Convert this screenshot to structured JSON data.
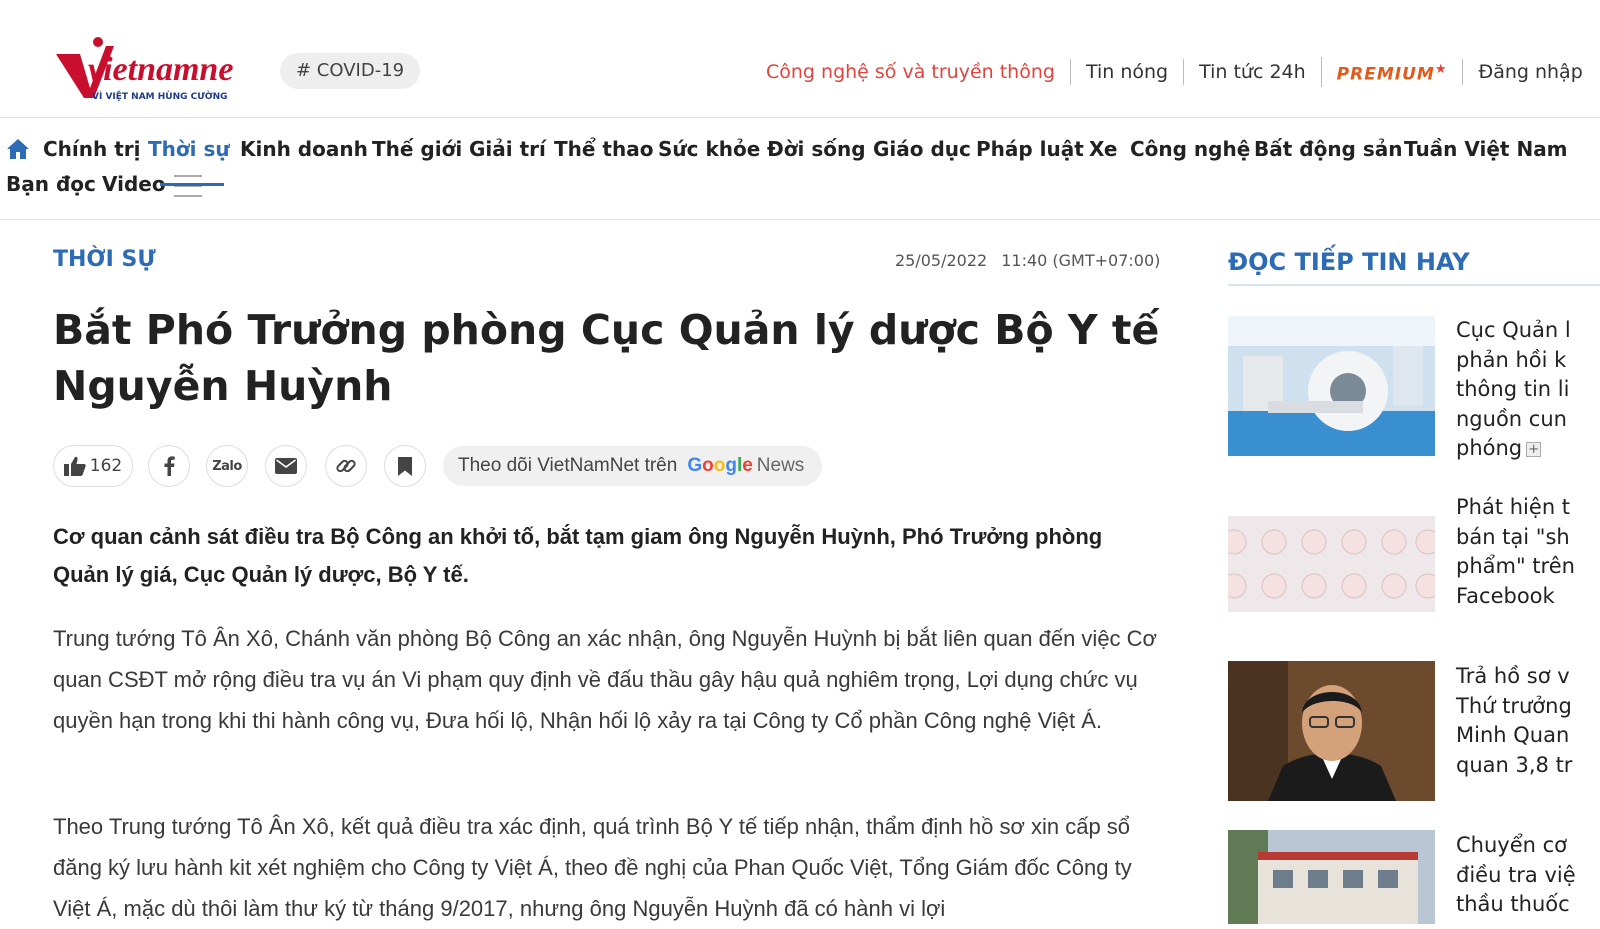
{
  "header": {
    "logo_text": "vietnamnet",
    "logo_tagline": "VÌ VIỆT NAM HÙNG CƯỜNG",
    "hashtag": "# COVID-19",
    "top_links": [
      "Công nghệ số và truyền thông",
      "Tin nóng",
      "Tin tức 24h",
      "PREMIUM",
      "Đăng nhập"
    ]
  },
  "nav": {
    "items": [
      "Chính trị",
      "Thời sự",
      "Kinh doanh",
      "Thế giới",
      "Giải trí",
      "Thể thao",
      "Sức khỏe",
      "Đời sống",
      "Giáo dục",
      "Pháp luật",
      "Xe",
      "Công nghệ",
      "Bất động sản",
      "Tuần Việt Nam",
      "Bạn đọc",
      "Video"
    ],
    "active": "Thời sự"
  },
  "article": {
    "category": "THỜI SỰ",
    "date": "25/05/2022",
    "time": "11:40 (GMT+07:00)",
    "title": "Bắt Phó Trưởng phòng Cục Quản lý dược Bộ Y tế Nguyễn Huỳnh",
    "likes": "162",
    "zalo_label": "Zalo",
    "follow_text": "Theo dõi VietNamNet trên",
    "google_word": "Google",
    "news_word": "News",
    "lead": "Cơ quan cảnh sát điều tra Bộ Công an khởi tố, bắt tạm giam ông Nguyễn Huỳnh, Phó Trưởng phòng Quản lý giá, Cục Quản lý dược, Bộ Y tế.",
    "paragraphs": [
      "Trung tướng Tô Ân Xô, Chánh văn phòng Bộ Công an xác nhận, ông Nguyễn Huỳnh bị bắt liên quan đến việc Cơ quan CSĐT mở rộng điều tra vụ án Vi phạm quy định về đấu thầu gây hậu quả nghiêm trọng, Lợi dụng chức vụ quyền hạn trong khi thi hành công vụ, Đưa hối lộ, Nhận hối lộ xảy ra tại Công ty Cổ phần Công nghệ Việt Á.",
      "Theo Trung tướng Tô Ân Xô, kết quả điều tra xác định, quá trình Bộ Y tế tiếp nhận, thẩm định hồ sơ xin cấp sổ đăng ký lưu hành kit xét nghiệm cho Công ty Việt Á, theo đề nghị của Phan Quốc Việt, Tổng Giám đốc Công ty Việt Á, mặc dù thôi làm thư ký từ tháng 9/2017, nhưng ông Nguyễn Huỳnh đã có hành vi lợi"
    ]
  },
  "sidebar": {
    "heading": "ĐỌC TIẾP TIN HAY",
    "items": [
      {
        "lines": [
          "Cục Quản l",
          "phản hồi k",
          "thông tin li",
          "nguồn cun",
          "phóng"
        ],
        "has_plus": true
      },
      {
        "lines": [
          "Phát hiện t",
          "bán tại \"sh",
          "phẩm\" trên",
          "Facebook"
        ],
        "has_plus": false
      },
      {
        "lines": [
          "Trả hồ sơ v",
          "Thứ trưởng",
          "Minh Quan",
          "quan 3,8 tr"
        ],
        "has_plus": false
      },
      {
        "lines": [
          "Chuyển cơ",
          "điều tra việ",
          "thầu thuốc"
        ],
        "has_plus": false
      }
    ]
  },
  "colors": {
    "accent_blue": "#2d6bb5",
    "logo_red": "#c8102e",
    "link_red": "#e0443e",
    "premium_orange": "#e05a1a"
  }
}
